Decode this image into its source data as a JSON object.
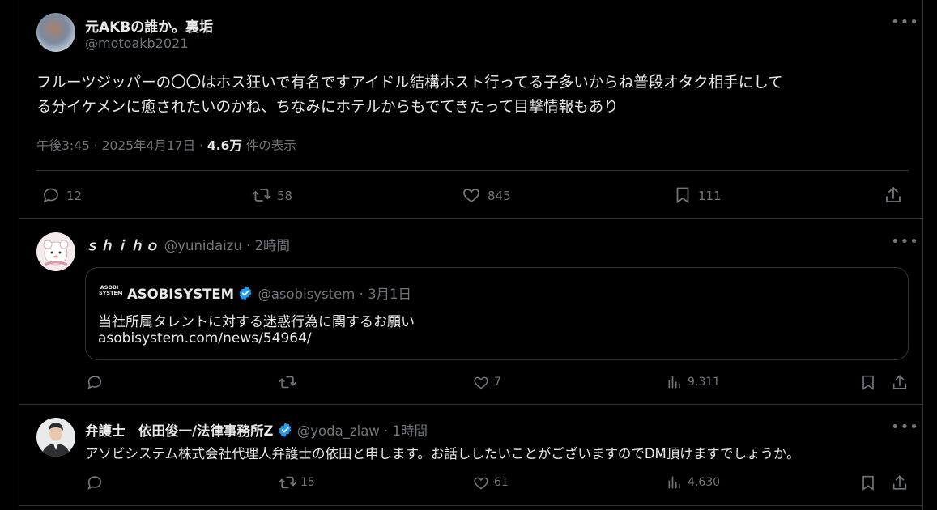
{
  "main_post": {
    "display_name": "元AKBの誰か。裏垢",
    "handle": "@motoakb2021",
    "text_line1": "フルーツジッパーの〇〇はホス狂いで有名ですアイドル結構ホスト行ってる子多いからね普段オタク相手にして",
    "text_line2": "る分イケメンに癒されたいのかね、ちなみにホテルからもでてきたって目撃情報もあり",
    "time": "午後3:45 · 2025年4月17日 · ",
    "views_count": "4.6万",
    "views_label": " 件の表示",
    "replies": "12",
    "reposts": "58",
    "likes": "845",
    "bookmarks": "111"
  },
  "reply1": {
    "display_name": "ｓｈｉｈｏ",
    "handle": "@yunidaizu",
    "time": " · 2時間",
    "quote": {
      "logo_line1": "ASOBI",
      "logo_line2": "SYSTEM",
      "name": "ASOBISYSTEM",
      "handle": "@asobisystem",
      "date": " · 3月1日",
      "line1": "当社所属タレントに対する迷惑行為に関するお願い",
      "line2": "asobisystem.com/news/54964/"
    },
    "replies": "",
    "reposts": "",
    "likes": "7",
    "views": "9,311"
  },
  "reply2": {
    "display_name": "弁護士　依田俊一/法律事務所Z",
    "handle": "@yoda_zlaw",
    "time": " · 1時間",
    "text": "アソビシステム株式会社代理人弁護士の依田と申します。お話ししたいことがございますのでDM頂けますでしょうか。",
    "replies": "",
    "reposts": "15",
    "likes": "61",
    "views": "4,630"
  },
  "colors": {
    "background": "#000000",
    "text": "#e7e9ea",
    "muted": "#71767b",
    "border": "#2f3336",
    "verified": "#1d9bf0"
  }
}
